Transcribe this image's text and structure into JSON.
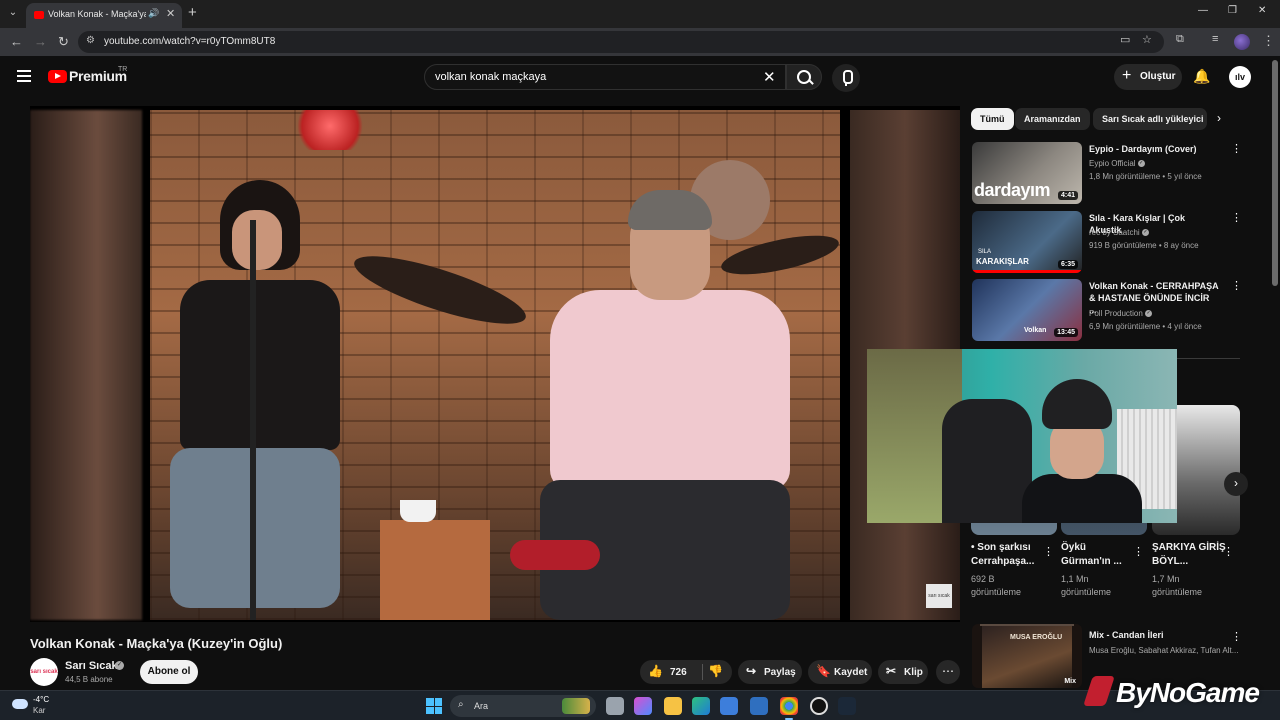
{
  "browser": {
    "tab_title": "Volkan Konak - Maçka'ya (K",
    "url": "youtube.com/watch?v=r0yTOmm8UT8"
  },
  "header": {
    "brand": "Premium",
    "country_code": "TR",
    "search_query": "volkan konak maçkaya",
    "create_label": "Oluştur",
    "avatar_label": "ılv"
  },
  "video": {
    "title": "Volkan Konak - Maçka'ya (Kuzey'in Oğlu)",
    "watermark": "sarı sıcak",
    "channel": {
      "name": "Sarı Sıcak",
      "subscribers": "44,5 B abone",
      "avatar_text": "sarı sıcak",
      "subscribe_label": "Abone ol"
    },
    "actions": {
      "likes": "726",
      "share": "Paylaş",
      "save": "Kaydet",
      "clip": "Klip"
    }
  },
  "sidebar": {
    "chips": [
      {
        "label": "Tümü",
        "active": true
      },
      {
        "label": "Aramanızdan",
        "active": false
      },
      {
        "label": "Sarı Sıcak adlı yükleyici",
        "active": false
      }
    ],
    "related": [
      {
        "title": "Eypio - Dardayım (Cover)",
        "channel": "Eypio Official",
        "meta": "1,8 Mn görüntüleme • 5 yıl önce",
        "duration": "4:41",
        "thumb_text": "dardayım"
      },
      {
        "title": "Sıla - Kara Kışlar | Çok Akustik",
        "channel": "rec by Saatchi",
        "meta": "919 B görüntüleme • 8 ay önce",
        "duration": "6:35",
        "thumb_text": "KARAKIŞLAR",
        "thumb_sub": "SILA"
      },
      {
        "title": "Volkan Konak - CERRAHPAŞA & HASTANE ÖNÜNDE İNCİR ...",
        "channel": "Poll Production",
        "meta": "6,9 Mn görüntüleme • 4 yıl önce",
        "duration": "13:45",
        "thumb_text": "Volkan"
      }
    ],
    "shorts": [
      {
        "title": "• Son şarkısı Cerrahpaşa...",
        "views": "692 B",
        "views_label": "görüntüleme"
      },
      {
        "title": "Öykü Gürman'ın ...",
        "views": "1,1 Mn",
        "views_label": "görüntüleme"
      },
      {
        "title": "ŞARKIYA GİRİŞ BÖYL...",
        "views": "1,7 Mn",
        "views_label": "görüntüleme"
      }
    ],
    "mix": {
      "title": "Mix - Candan İleri",
      "subtitle": "Musa Eroğlu, Sabahat Akkiraz, Tufan Alt...",
      "badge": "Mix",
      "art_title": "MUSA EROĞLU"
    }
  },
  "taskbar": {
    "temperature": "-4°C",
    "weather": "Kar",
    "search_placeholder": "Ara"
  },
  "overlay": {
    "watermark": "ByNoGame"
  },
  "colors": {
    "accent": "#ff0000",
    "background": "#0f0f0f"
  }
}
